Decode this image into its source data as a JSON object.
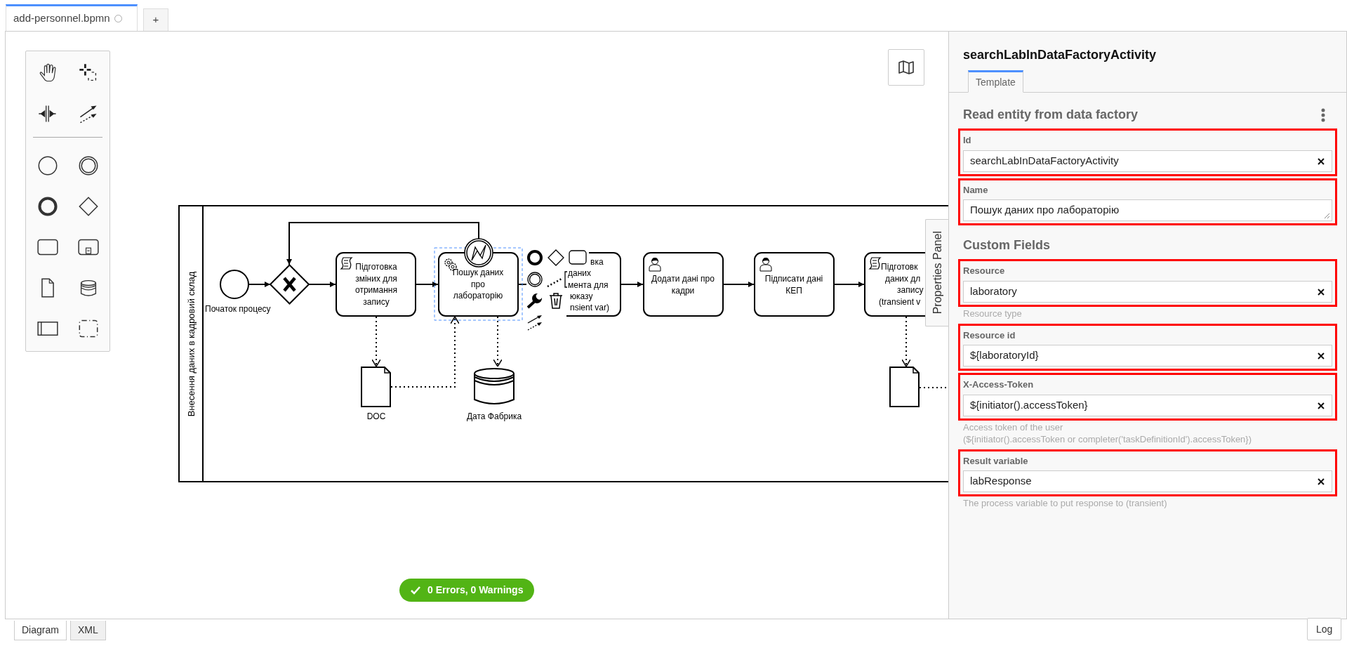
{
  "file_tabs": [
    {
      "label": "add-personnel.bpmn",
      "selected": true,
      "dirty": true
    },
    {
      "label": "+",
      "selected": false
    }
  ],
  "diagram": {
    "lane_label": "Внесення даних в кадровий склад",
    "nodes": [
      {
        "kind": "start_event",
        "label": "Початок процесу"
      },
      {
        "kind": "gateway"
      },
      {
        "kind": "script_task",
        "lines": [
          "Підготовка",
          "зміних для",
          "отримання",
          "запису"
        ],
        "selected": false
      },
      {
        "kind": "service_task",
        "lines": [
          "Пошук даних",
          "про",
          "лабораторію"
        ],
        "selected": true
      },
      {
        "kind": "task",
        "lines": [
          "вка",
          "даних",
          "мента для",
          "юказу",
          "nsient var)"
        ],
        "selected": false
      },
      {
        "kind": "user_task",
        "lines": [
          "Додати дані про",
          "кадри"
        ],
        "selected": false
      },
      {
        "kind": "user_task",
        "lines": [
          "Підписати дані",
          "КЕП"
        ],
        "selected": false
      },
      {
        "kind": "script_task",
        "lines": [
          "Підготовк",
          "даних дл",
          "запису",
          "(transient v"
        ],
        "selected": false
      },
      {
        "kind": "data_object",
        "label": "DOC"
      },
      {
        "kind": "data_store",
        "label": "Дата Фабрика"
      },
      {
        "kind": "data_object"
      }
    ]
  },
  "validation": {
    "text": "0 Errors, 0 Warnings"
  },
  "properties_tab": "Properties Panel",
  "panel": {
    "title": "searchLabInDataFactoryActivity",
    "tabs": [
      {
        "label": "Template",
        "selected": true
      }
    ],
    "group_title": "Read entity from data factory",
    "fields": [
      {
        "label": "Id",
        "value": "searchLabInDataFactoryActivity",
        "kind": "input",
        "highlighted": true
      },
      {
        "label": "Name",
        "value": "Пошук даних про лабораторію",
        "kind": "textarea",
        "highlighted": true
      }
    ],
    "section_title": "Custom Fields",
    "custom_fields": [
      {
        "label": "Resource",
        "value": "laboratory",
        "kind": "input",
        "highlighted": true,
        "description": [
          "Resource type"
        ]
      },
      {
        "label": "Resource id",
        "value": "${laboratoryId}",
        "kind": "input",
        "highlighted": true
      },
      {
        "label": "X-Access-Token",
        "value": "${initiator().accessToken}",
        "kind": "input",
        "highlighted": true,
        "description": [
          "Access token of the user",
          "(${initiator().accessToken or completer('taskDefinitionId').accessToken})"
        ]
      },
      {
        "label": "Result variable",
        "value": "labResponse",
        "kind": "input",
        "highlighted": true,
        "description": [
          "The process variable to put response to (transient)"
        ]
      }
    ]
  },
  "view_tabs": [
    {
      "label": "Diagram",
      "selected": true
    },
    {
      "label": "XML",
      "selected": false
    }
  ],
  "log_button": "Log"
}
